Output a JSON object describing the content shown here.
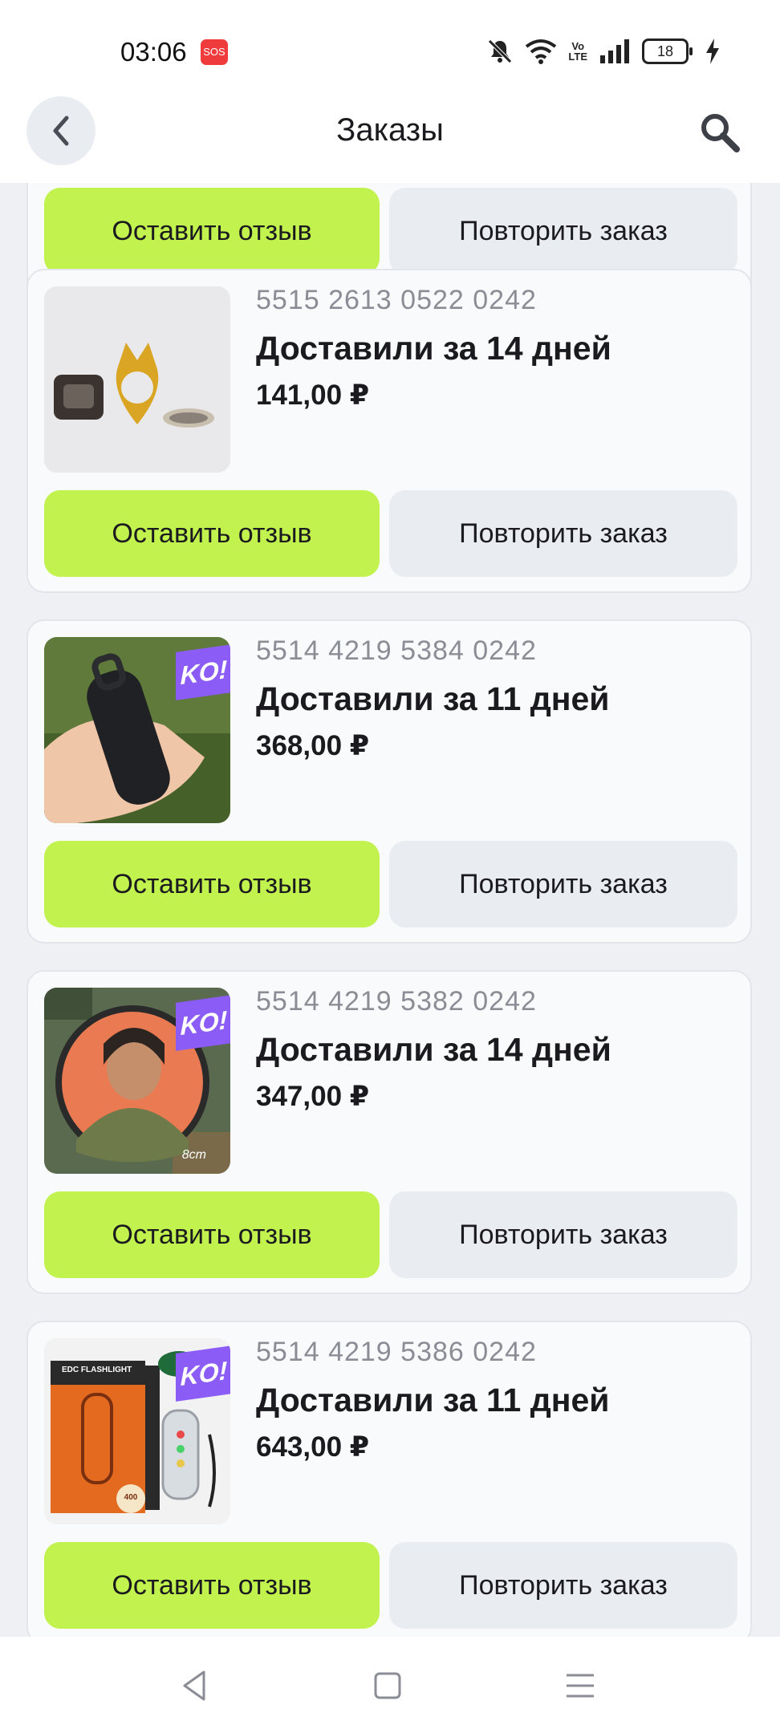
{
  "status_bar": {
    "time": "03:06",
    "sos": "SOS",
    "battery": "18",
    "volte_line1": "Vo",
    "volte_line2": "LTE"
  },
  "header": {
    "title": "Заказы"
  },
  "partial_card": {
    "review_label": "Оставить отзыв",
    "repeat_label": "Повторить заказ"
  },
  "orders": [
    {
      "number": "5515 2613 0522 0242",
      "status": "Доставили за 14 дней",
      "price": "141,00 ₽",
      "review_label": "Оставить отзыв",
      "repeat_label": "Повторить заказ",
      "badge": ""
    },
    {
      "number": "5514 4219 5384 0242",
      "status": "Доставили за 11 дней",
      "price": "368,00 ₽",
      "review_label": "Оставить отзыв",
      "repeat_label": "Повторить заказ",
      "badge": "KO!"
    },
    {
      "number": "5514 4219 5382 0242",
      "status": "Доставили за 14 дней",
      "price": "347,00 ₽",
      "review_label": "Оставить отзыв",
      "repeat_label": "Повторить заказ",
      "badge": "KO!",
      "image_caption": "8cm"
    },
    {
      "number": "5514 4219 5386 0242",
      "status": "Доставили за 11 дней",
      "price": "643,00 ₽",
      "review_label": "Оставить отзыв",
      "repeat_label": "Повторить заказ",
      "badge": "KO!",
      "image_box_title": "EDC FLASHLIGHT",
      "image_box_badge": "400"
    }
  ],
  "colors": {
    "accent_green": "#c1f24e",
    "secondary_button": "#e9ecf1",
    "badge_purple": "#8b5cf6",
    "background": "#eef0f4"
  },
  "icons": [
    "back-icon",
    "search-icon",
    "mute-icon",
    "wifi-icon",
    "signal-icon",
    "battery-icon",
    "charging-icon",
    "nav-back-icon",
    "nav-home-icon",
    "nav-menu-icon"
  ]
}
